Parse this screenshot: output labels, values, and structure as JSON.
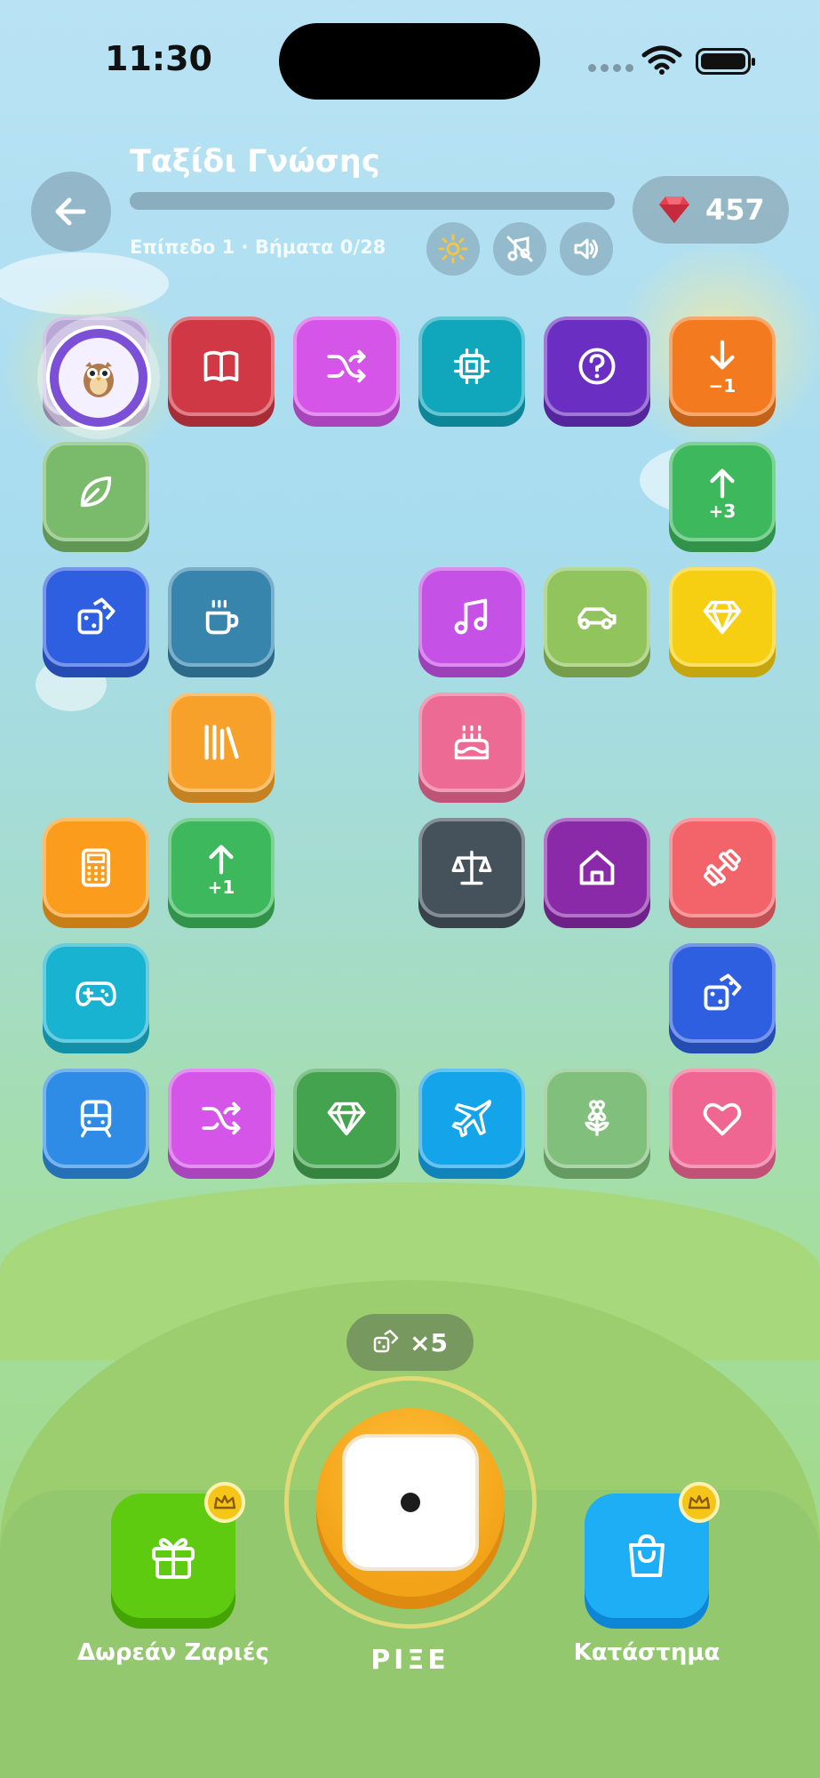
{
  "status_bar": {
    "time": "11:30"
  },
  "header": {
    "title": "Ταξίδι Γνώσης",
    "subtitle": "Επίπεδο 1 · Βήματα 0/28",
    "progress": 0.0,
    "gems": "457"
  },
  "board": {
    "player_icon": "owl-avatar",
    "tiles": [
      {
        "name": "tile-start",
        "icon": "start-icon",
        "label": "",
        "color": "#b9a8d6"
      },
      {
        "name": "tile-book",
        "icon": "book-icon",
        "label": "",
        "color": "#d03845"
      },
      {
        "name": "tile-shuffle-1",
        "icon": "shuffle-icon",
        "label": "",
        "color": "#d455e8"
      },
      {
        "name": "tile-chip",
        "icon": "chip-icon",
        "label": "",
        "color": "#10a7bd"
      },
      {
        "name": "tile-question",
        "icon": "question-icon",
        "label": "",
        "color": "#6a2ec2"
      },
      {
        "name": "tile-back-1",
        "icon": "arrow-down-icon",
        "label": "−1",
        "color": "#f47a1f"
      },
      {
        "name": "tile-leaf",
        "icon": "leaf-icon",
        "label": "",
        "color": "#79bb6a"
      },
      {
        "name": "tile-forward-3",
        "icon": "arrow-up-icon",
        "label": "+3",
        "color": "#3db85c"
      },
      {
        "name": "tile-dice-1",
        "icon": "dice-icon",
        "label": "",
        "color": "#2e5fe0"
      },
      {
        "name": "tile-coffee",
        "icon": "coffee-icon",
        "label": "",
        "color": "#3785ad"
      },
      {
        "name": "tile-music",
        "icon": "music-icon",
        "label": "",
        "color": "#c651e6"
      },
      {
        "name": "tile-car",
        "icon": "car-icon",
        "label": "",
        "color": "#92c45d"
      },
      {
        "name": "tile-gem-1",
        "icon": "gem-icon",
        "label": "",
        "color": "#f7cf12"
      },
      {
        "name": "tile-library",
        "icon": "library-icon",
        "label": "",
        "color": "#f7a12a"
      },
      {
        "name": "tile-cake",
        "icon": "cake-icon",
        "label": "",
        "color": "#ec6a93"
      },
      {
        "name": "tile-calculator",
        "icon": "calculator-icon",
        "label": "",
        "color": "#fb9c1c"
      },
      {
        "name": "tile-forward-1",
        "icon": "arrow-up-icon",
        "label": "+1",
        "color": "#3db85c"
      },
      {
        "name": "tile-scale",
        "icon": "scale-icon",
        "label": "",
        "color": "#45525c"
      },
      {
        "name": "tile-home",
        "icon": "home-icon",
        "label": "",
        "color": "#8a2aa9"
      },
      {
        "name": "tile-dumbbell",
        "icon": "dumbbell-icon",
        "label": "",
        "color": "#f2646a"
      },
      {
        "name": "tile-gamepad",
        "icon": "gamepad-icon",
        "label": "",
        "color": "#18b3d1"
      },
      {
        "name": "tile-dice-2",
        "icon": "dice-icon",
        "label": "",
        "color": "#2e5fe0"
      },
      {
        "name": "tile-train",
        "icon": "train-icon",
        "label": "",
        "color": "#2f8ce6"
      },
      {
        "name": "tile-shuffle-2",
        "icon": "shuffle-icon",
        "label": "",
        "color": "#d455e8"
      },
      {
        "name": "tile-gem-2",
        "icon": "gem-icon",
        "label": "",
        "color": "#44a34f"
      },
      {
        "name": "tile-plane",
        "icon": "plane-icon",
        "label": "",
        "color": "#14a4ea"
      },
      {
        "name": "tile-flower",
        "icon": "flower-icon",
        "label": "",
        "color": "#80c07c"
      },
      {
        "name": "tile-heart",
        "icon": "heart-icon",
        "label": "",
        "color": "#ef6693"
      }
    ]
  },
  "controls": {
    "dice_count": "×5",
    "roll_label": "ΡΙΞΕ",
    "free_dice_label": "Δωρεάν Ζαριές",
    "shop_label": "Κατάστημα"
  }
}
